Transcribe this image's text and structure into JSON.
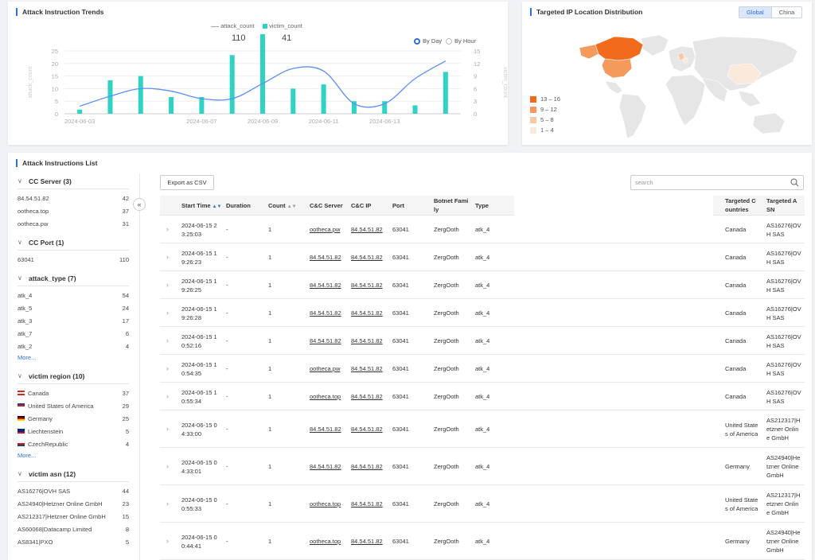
{
  "trend": {
    "title": "Attack Instruction Trends",
    "legend": [
      {
        "name": "attack_count",
        "total": "110",
        "color": "#aaaaaa"
      },
      {
        "name": "victim_count",
        "total": "41",
        "color": "#2ed3c3"
      }
    ],
    "radios": [
      {
        "label": "By Day",
        "selected": true
      },
      {
        "label": "By Hour",
        "selected": false
      }
    ]
  },
  "chart_data": {
    "type": "line",
    "x": [
      "2024-06-03",
      "2024-06-04",
      "2024-06-05",
      "2024-06-06",
      "2024-06-07",
      "2024-06-08",
      "2024-06-09",
      "2024-06-10",
      "2024-06-11",
      "2024-06-12",
      "2024-06-13",
      "2024-06-14",
      "2024-06-15"
    ],
    "x_tick_labels": [
      "2024-06-03",
      "2024-06-07",
      "2024-06-09",
      "2024-06-11",
      "2024-06-13"
    ],
    "series": [
      {
        "name": "attack_count",
        "chart": "line",
        "axis": "left",
        "color": "#5b8ff9",
        "values": [
          3,
          7,
          10,
          9,
          6,
          6,
          12,
          18,
          17,
          4,
          4,
          14,
          21
        ]
      },
      {
        "name": "victim_count",
        "chart": "bar",
        "axis": "right",
        "color": "#2ed3c3",
        "values": [
          1,
          8,
          9,
          4,
          4,
          14,
          19,
          6,
          7,
          3,
          3,
          2,
          10
        ]
      }
    ],
    "ylabel_left": "attack_count",
    "ylabel_right": "victim_count",
    "ylim_left": [
      0,
      25
    ],
    "yticks_left": [
      0,
      5,
      10,
      15,
      20,
      25
    ],
    "ylim_right": [
      0,
      15
    ],
    "yticks_right": [
      0,
      3,
      6,
      9,
      12,
      15
    ],
    "grid": true
  },
  "map": {
    "title": "Targeted IP Location Distribution",
    "tabs": [
      {
        "label": "Global",
        "active": true
      },
      {
        "label": "China",
        "active": false
      }
    ],
    "legend": [
      {
        "label": "13 – 16",
        "color": "#f26a1b"
      },
      {
        "label": "9 – 12",
        "color": "#f39a5c"
      },
      {
        "label": "5 – 8",
        "color": "#f7c9a6"
      },
      {
        "label": "1 – 4",
        "color": "#fbe9dc"
      }
    ]
  },
  "list": {
    "title": "Attack Instructions List",
    "export_label": "Export as CSV",
    "search_placeholder": "search",
    "collapse_icon": "«",
    "filters": [
      {
        "title": "CC Server (3)",
        "items": [
          {
            "label": "84.54.51.82",
            "count": "42"
          },
          {
            "label": "ootheca.top",
            "count": "37"
          },
          {
            "label": "ootheca.pw",
            "count": "31"
          }
        ]
      },
      {
        "title": "CC Port (1)",
        "items": [
          {
            "label": "63041",
            "count": "110"
          }
        ]
      },
      {
        "title": "attack_type (7)",
        "items": [
          {
            "label": "atk_4",
            "count": "54"
          },
          {
            "label": "atk_5",
            "count": "24"
          },
          {
            "label": "atk_3",
            "count": "17"
          },
          {
            "label": "atk_7",
            "count": "6"
          },
          {
            "label": "atk_2",
            "count": "4"
          }
        ],
        "more": "More..."
      },
      {
        "title": "victim region (10)",
        "items": [
          {
            "label": "Canada",
            "count": "37",
            "flag": "ca"
          },
          {
            "label": "United States of America",
            "count": "29",
            "flag": "us"
          },
          {
            "label": "Germany",
            "count": "25",
            "flag": "de"
          },
          {
            "label": "Liechtenstein",
            "count": "5",
            "flag": "li"
          },
          {
            "label": "CzechRepublic",
            "count": "4",
            "flag": "cz"
          }
        ],
        "more": "More..."
      },
      {
        "title": "victim asn (12)",
        "items": [
          {
            "label": "AS16276|OVH SAS",
            "count": "44"
          },
          {
            "label": "AS24940|Hetzner Online GmbH",
            "count": "23"
          },
          {
            "label": "AS212317|Hetzner Online GmbH",
            "count": "15"
          },
          {
            "label": "AS60068|Datacamp Limited",
            "count": "8"
          },
          {
            "label": "AS8341|PXO",
            "count": "5"
          }
        ]
      }
    ],
    "columns": {
      "start_time": "Start Time",
      "duration": "Duration",
      "count": "Count",
      "cc_server": "C&C Server",
      "cc_ip": "C&C IP",
      "port": "Port",
      "botnet_family": [
        "Botnet Fami",
        "ly"
      ],
      "type": "Type",
      "countries": [
        "Targeted C",
        "ountries"
      ],
      "asn": [
        "Targeted A",
        "SN"
      ]
    },
    "rows": [
      {
        "time": [
          "2024-06-15 2",
          "3:25:03"
        ],
        "duration": "-",
        "count": "1",
        "server": "ootheca.pw",
        "ip": "84.54.51.82",
        "port": "63041",
        "family": "ZergOoth",
        "type": "atk_4",
        "country": [
          "Canada"
        ],
        "asn": [
          "AS16276|OV",
          "H SAS"
        ]
      },
      {
        "time": [
          "2024-06-15 1",
          "9:26:23"
        ],
        "duration": "-",
        "count": "1",
        "server": "84.54.51.82",
        "ip": "84.54.51.82",
        "port": "63041",
        "family": "ZergOoth",
        "type": "atk_4",
        "country": [
          "Canada"
        ],
        "asn": [
          "AS16276|OV",
          "H SAS"
        ]
      },
      {
        "time": [
          "2024-06-15 1",
          "9:26:25"
        ],
        "duration": "-",
        "count": "1",
        "server": "84.54.51.82",
        "ip": "84.54.51.82",
        "port": "63041",
        "family": "ZergOoth",
        "type": "atk_4",
        "country": [
          "Canada"
        ],
        "asn": [
          "AS16276|OV",
          "H SAS"
        ]
      },
      {
        "time": [
          "2024-06-15 1",
          "9:26:28"
        ],
        "duration": "-",
        "count": "1",
        "server": "84.54.51.82",
        "ip": "84.54.51.82",
        "port": "63041",
        "family": "ZergOoth",
        "type": "atk_4",
        "country": [
          "Canada"
        ],
        "asn": [
          "AS16276|OV",
          "H SAS"
        ]
      },
      {
        "time": [
          "2024-06-15 1",
          "0:52:16"
        ],
        "duration": "-",
        "count": "1",
        "server": "84.54.51.82",
        "ip": "84.54.51.82",
        "port": "63041",
        "family": "ZergOoth",
        "type": "atk_4",
        "country": [
          "Canada"
        ],
        "asn": [
          "AS16276|OV",
          "H SAS"
        ]
      },
      {
        "time": [
          "2024-06-15 1",
          "0:54:35"
        ],
        "duration": "-",
        "count": "1",
        "server": "ootheca.pw",
        "ip": "84.54.51.82",
        "port": "63041",
        "family": "ZergOoth",
        "type": "atk_4",
        "country": [
          "Canada"
        ],
        "asn": [
          "AS16276|OV",
          "H SAS"
        ]
      },
      {
        "time": [
          "2024-06-15 1",
          "0:55:34"
        ],
        "duration": "-",
        "count": "1",
        "server": "ootheca.top",
        "ip": "84.54.51.82",
        "port": "63041",
        "family": "ZergOoth",
        "type": "atk_4",
        "country": [
          "Canada"
        ],
        "asn": [
          "AS16276|OV",
          "H SAS"
        ]
      },
      {
        "time": [
          "2024-06-15 0",
          "4:33:00"
        ],
        "duration": "-",
        "count": "1",
        "server": "84.54.51.82",
        "ip": "84.54.51.82",
        "port": "63041",
        "family": "ZergOoth",
        "type": "atk_4",
        "country": [
          "United State",
          "s of America"
        ],
        "asn": [
          "AS212317|H",
          "etzner Onlin",
          "e GmbH"
        ]
      },
      {
        "time": [
          "2024-06-15 0",
          "4:33:01"
        ],
        "duration": "-",
        "count": "1",
        "server": "84.54.51.82",
        "ip": "84.54.51.82",
        "port": "63041",
        "family": "ZergOoth",
        "type": "atk_4",
        "country": [
          "Germany"
        ],
        "asn": [
          "AS24940|He",
          "tzner Online",
          "GmbH"
        ]
      },
      {
        "time": [
          "2024-06-15 0",
          "0:55:33"
        ],
        "duration": "-",
        "count": "1",
        "server": "ootheca.top",
        "ip": "84.54.51.82",
        "port": "63041",
        "family": "ZergOoth",
        "type": "atk_4",
        "country": [
          "United State",
          "s of America"
        ],
        "asn": [
          "AS212317|H",
          "etzner Onlin",
          "e GmbH"
        ]
      },
      {
        "time": [
          "2024-06-15 0",
          "0:44:41"
        ],
        "duration": "-",
        "count": "1",
        "server": "ootheca.top",
        "ip": "84.54.51.82",
        "port": "63041",
        "family": "ZergOoth",
        "type": "atk_4",
        "country": [
          "Germany"
        ],
        "asn": [
          "AS24940|He",
          "tzner Online",
          "GmbH"
        ]
      }
    ]
  }
}
